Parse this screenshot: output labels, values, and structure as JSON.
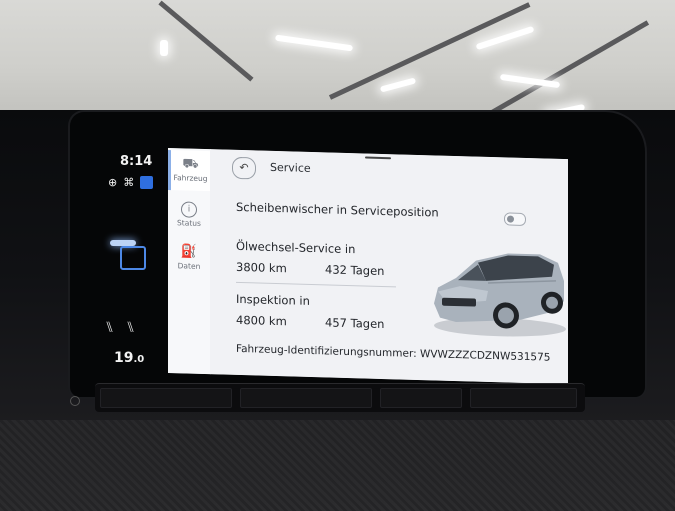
{
  "status_bar": {
    "time": "8:14",
    "temperature": "19",
    "temperature_decimal": ".0",
    "icons": [
      "gps-icon",
      "seat-heating-icon",
      "bluetooth-icon"
    ]
  },
  "side_nav": {
    "items": [
      {
        "label": "Fahrzeug",
        "icon": "car-icon",
        "active": true
      },
      {
        "label": "Status",
        "icon": "info-icon",
        "active": false
      },
      {
        "label": "Daten",
        "icon": "fuel-icon",
        "active": false
      }
    ]
  },
  "header": {
    "back_label": "↶",
    "title": "Service"
  },
  "wiper": {
    "label": "Scheibenwischer in Serviceposition",
    "enabled": false
  },
  "oil_service": {
    "label": "Ölwechsel-Service in",
    "distance": "3800 km",
    "days": "432 Tagen"
  },
  "inspection": {
    "label": "Inspektion in",
    "distance": "4800 km",
    "days": "457 Tagen"
  },
  "vin": {
    "text": "Fahrzeug-Identifizierungsnummer: WVWZZZCDZNW531575"
  },
  "colors": {
    "accent": "#8cb0e8",
    "bluetooth": "#2f6fe0",
    "screen_bg": "#f1f2f5"
  }
}
